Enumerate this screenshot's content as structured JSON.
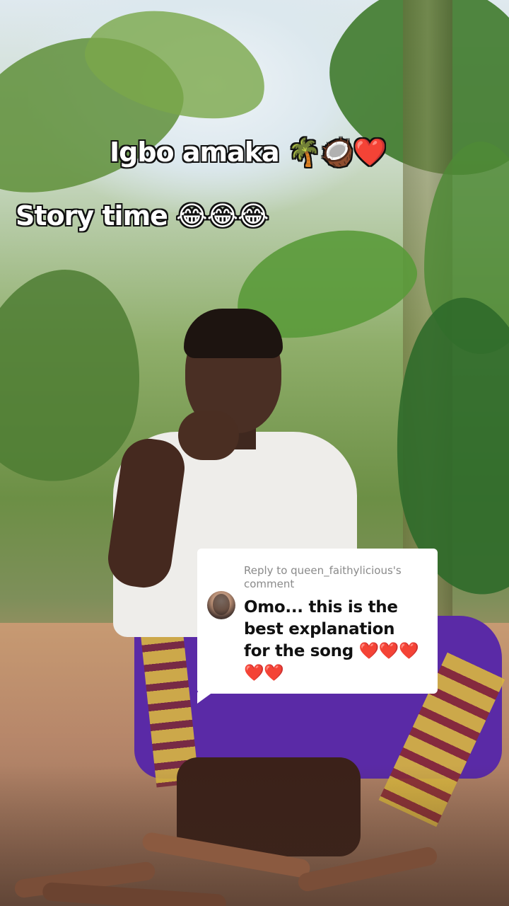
{
  "captions": {
    "line1": "Igbo amaka 🌴🥥❤️",
    "line2": "Story time 😂😂😂"
  },
  "reply": {
    "header": "Reply to queen_faithylicious's comment",
    "comment": "Omo... this is the best explanation for the song ❤️❤️❤️❤️❤️"
  },
  "colors": {
    "caption_text": "#ffffff",
    "caption_outline": "#111111",
    "reply_background": "#ffffff",
    "reply_header": "#8a8a8a",
    "reply_text": "#111111"
  },
  "icons": {
    "avatar": "commenter-avatar"
  }
}
